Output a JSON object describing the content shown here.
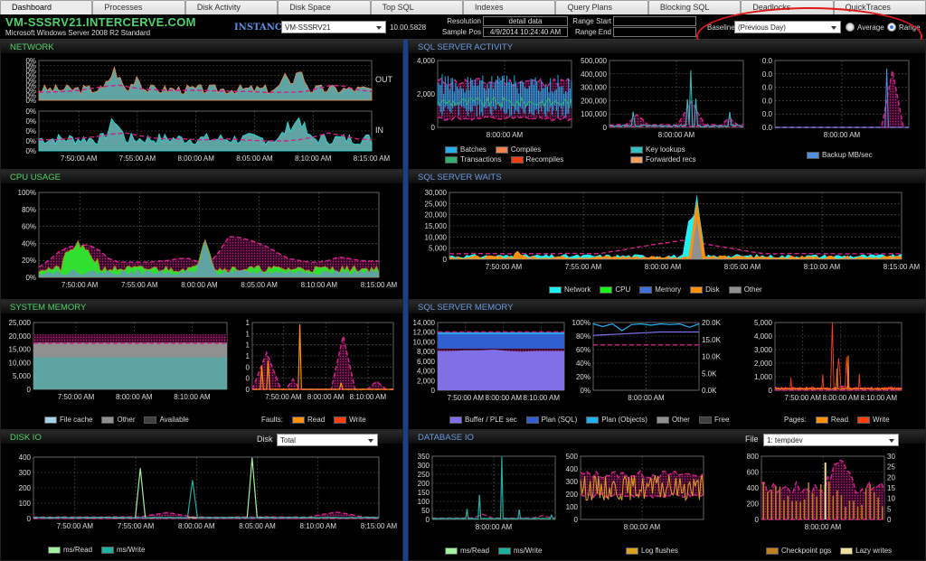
{
  "tabs": [
    {
      "label": "Dashboard",
      "active": true
    },
    {
      "label": "Processes"
    },
    {
      "label": "Disk Activity"
    },
    {
      "label": "Disk Space"
    },
    {
      "label": "Top SQL"
    },
    {
      "label": "Indexes"
    },
    {
      "label": "Query Plans"
    },
    {
      "label": "Blocking SQL"
    },
    {
      "label": "Deadlocks"
    },
    {
      "label": "QuickTraces"
    }
  ],
  "header": {
    "hostname": "VM-SSSRV21.INTERCERVE.COM",
    "os": "Microsoft Windows Server 2008 R2 Standard",
    "instance_label": "INSTANCE",
    "instance_value": "VM-SSSRV21",
    "version": "10.00.5828",
    "resolution_label": "Resolution",
    "resolution_value": "detail data",
    "sample_pos_label": "Sample Pos",
    "sample_pos_value": "4/9/2014 10:24:40 AM",
    "range_start_label": "Range Start",
    "range_start_value": "",
    "range_end_label": "Range End",
    "range_end_value": "",
    "baseline_label": "Baseline",
    "baseline_value": "(Previous Day)",
    "average_label": "Average",
    "range_label": "Range",
    "selected_mode": "Range"
  },
  "panels": {
    "network": {
      "title": "NETWORK",
      "out_label": "OUT",
      "in_label": "IN"
    },
    "sql_activity": {
      "title": "SQL SERVER ACTIVITY"
    },
    "cpu": {
      "title": "CPU USAGE"
    },
    "sql_waits": {
      "title": "SQL SERVER WAITS"
    },
    "system_memory": {
      "title": "SYSTEM MEMORY",
      "faults_label": "Faults:"
    },
    "sql_memory": {
      "title": "SQL SERVER MEMORY",
      "pages_label": "Pages:"
    },
    "disk_io": {
      "title": "DISK IO",
      "disk_label": "Disk",
      "disk_value": "Total"
    },
    "database_io": {
      "title": "DATABASE IO",
      "file_label": "File",
      "file_value": "1: tempdev"
    }
  },
  "colors": {
    "baseline": "#d0208a",
    "teal": "#5fa3a3",
    "cyan": "#20e0e0",
    "orange": "#ff9010",
    "green": "#30e030"
  },
  "chart_data": [
    {
      "id": "net_out",
      "type": "area",
      "yticks": [
        "0%",
        "0%",
        "0%",
        "0%",
        "0%",
        "0%",
        "0%",
        "0%",
        "0%"
      ],
      "xticks": [],
      "series": [
        {
          "name": "Out",
          "color": "#e88850"
        }
      ],
      "values": [
        0.22,
        0.26,
        0.2,
        0.3,
        0.25,
        0.24,
        0.3,
        0.28,
        0.45,
        0.7,
        0.35,
        0.55,
        0.3,
        0.25,
        0.22,
        0.2,
        0.25,
        0.24,
        0.22,
        0.25,
        0.2,
        0.25,
        0.23,
        0.28,
        0.3,
        0.35,
        0.4,
        0.55,
        0.5,
        0.75,
        0.3,
        0.25,
        0.22,
        0.2,
        0.25,
        0.24,
        0.2,
        0.25,
        0.22,
        0.3
      ],
      "baseline": [
        0.2,
        0.21,
        0.22,
        0.25,
        0.3,
        0.35,
        0.38,
        0.32,
        0.28,
        0.26,
        0.25,
        0.25,
        0.25,
        0.24,
        0.23,
        0.22,
        0.22,
        0.2,
        0.2,
        0.2,
        0.22,
        0.3,
        0.38,
        0.35,
        0.26,
        0.22
      ]
    },
    {
      "id": "net_in",
      "type": "area",
      "yticks": [
        "0%",
        "0%",
        "0%",
        "0%",
        "0%"
      ],
      "xticks": [
        "7:50:00 AM",
        "7:55:00 AM",
        "8:00:00 AM",
        "8:05:00 AM",
        "8:10:00 AM",
        "8:15:00 AM"
      ],
      "series": [
        {
          "name": "In",
          "color": "#20e0e0"
        }
      ],
      "values": [
        0.3,
        0.35,
        0.28,
        0.4,
        0.32,
        0.3,
        0.35,
        0.45,
        0.8,
        0.5,
        0.45,
        0.3,
        0.35,
        0.3,
        0.28,
        0.32,
        0.3,
        0.45,
        0.3,
        0.28,
        0.3,
        0.35,
        0.3,
        0.28,
        0.32,
        0.3,
        0.5,
        0.6,
        0.9,
        0.35,
        0.3,
        0.28,
        0.32,
        0.3,
        0.28,
        0.3,
        0.25,
        0.3,
        0.28,
        0.3
      ],
      "baseline": [
        0.28,
        0.28,
        0.3,
        0.32,
        0.36,
        0.42,
        0.45,
        0.38,
        0.32,
        0.3,
        0.3,
        0.28,
        0.28,
        0.3,
        0.28,
        0.26,
        0.25,
        0.25,
        0.28,
        0.35,
        0.45,
        0.38,
        0.3,
        0.28
      ]
    },
    {
      "id": "sql_batches",
      "type": "area",
      "yticks": [
        "4,000",
        "2,000",
        "0"
      ],
      "ymax": 5000,
      "xticks": [
        "8:00:00 AM"
      ],
      "legend": [
        {
          "name": "Batches",
          "color": "#20b0f0"
        },
        {
          "name": "Compiles",
          "color": "#f08050"
        },
        {
          "name": "Transactions",
          "color": "#30b070"
        },
        {
          "name": "Recompiles",
          "color": "#f04010"
        }
      ]
    },
    {
      "id": "sql_lookups",
      "type": "area",
      "yticks": [
        "500,000",
        "400,000",
        "300,000",
        "200,000",
        "100,000",
        "0"
      ],
      "ymax": 500000,
      "xticks": [
        "8:00:00 AM"
      ],
      "legend": [
        {
          "name": "Key lookups",
          "color": "#30c0c0"
        },
        {
          "name": "Forwarded recs",
          "color": "#f0a060"
        }
      ]
    },
    {
      "id": "sql_backup",
      "type": "area",
      "yticks": [
        "0.0",
        "0.0",
        "0.0",
        "0.0",
        "0.0",
        "0.0"
      ],
      "xticks": [
        "8:00:00 AM"
      ],
      "legend": [
        {
          "name": "Backup MB/sec",
          "color": "#5090e0"
        }
      ]
    },
    {
      "id": "cpu",
      "type": "area",
      "yticks": [
        "100%",
        "80%",
        "60%",
        "40%",
        "20%",
        "0%"
      ],
      "ymax": 100,
      "xticks": [
        "7:50:00 AM",
        "7:55:00 AM",
        "8:00:00 AM",
        "8:05:00 AM",
        "8:10:00 AM",
        "8:15:00 AM"
      ],
      "values": [
        8,
        9,
        10,
        12,
        25,
        28,
        30,
        27,
        12,
        10,
        11,
        12,
        10,
        9,
        10,
        11,
        12,
        10,
        11,
        12,
        10,
        9,
        11,
        13,
        15,
        45,
        30,
        15,
        18,
        12,
        10,
        11,
        10,
        12,
        14,
        10,
        11,
        12,
        10,
        9,
        10,
        11,
        12,
        10,
        9,
        10
      ],
      "baseline_high": [
        12,
        20,
        30,
        36,
        38,
        38,
        32,
        22,
        18,
        18,
        18,
        18,
        19,
        20,
        22,
        22,
        18,
        16,
        30,
        48,
        47,
        44,
        40,
        35,
        28,
        22,
        20,
        18,
        18,
        20,
        24,
        22,
        20,
        19,
        19
      ],
      "baseline_low": [
        6,
        6,
        7,
        8,
        9,
        9,
        8,
        7,
        6,
        7,
        8,
        8,
        7,
        6,
        6,
        6,
        7,
        8,
        9,
        8,
        7,
        5,
        4,
        4,
        5,
        6,
        7,
        8,
        8,
        7,
        6,
        5,
        5,
        5,
        5
      ]
    },
    {
      "id": "waits",
      "type": "area",
      "yticks": [
        "30,000",
        "25,000",
        "20,000",
        "15,000",
        "10,000",
        "5,000",
        "0"
      ],
      "ymax": 30000,
      "xticks": [
        "7:50:00 AM",
        "7:55:00 AM",
        "8:00:00 AM",
        "8:05:00 AM",
        "8:10:00 AM",
        "8:15:00 AM"
      ],
      "legend": [
        {
          "name": "Network",
          "color": "#20f0f0"
        },
        {
          "name": "CPU",
          "color": "#20f020"
        },
        {
          "name": "Memory",
          "color": "#4070e0"
        },
        {
          "name": "Disk",
          "color": "#ff9010"
        },
        {
          "name": "Other",
          "color": "#909090"
        }
      ]
    },
    {
      "id": "sys_mem",
      "type": "area",
      "yticks": [
        "25,000",
        "20,000",
        "15,000",
        "10,000",
        "5,000",
        "0"
      ],
      "ymax": 25000,
      "xticks": [
        "7:50:00 AM",
        "8:00:00 AM",
        "8:10:00 AM"
      ],
      "file_cache": 12000,
      "other": 17500,
      "available": 20500,
      "legend": [
        {
          "name": "File cache",
          "color": "#a8d0e8"
        },
        {
          "name": "Other",
          "color": "#909090"
        },
        {
          "name": "Available",
          "color": "#404040"
        }
      ]
    },
    {
      "id": "faults",
      "type": "area",
      "yticks": [
        "1",
        "1",
        "1",
        "1",
        "0",
        "0",
        "0"
      ],
      "xticks": [
        "7:50:00 AM",
        "8:00:00 AM",
        "8:10:00 AM"
      ],
      "legend": [
        {
          "name": "Read",
          "color": "#ff9010"
        },
        {
          "name": "Write",
          "color": "#ff4010"
        }
      ]
    },
    {
      "id": "sql_mem",
      "type": "area",
      "yticks": [
        "14,000",
        "12,000",
        "10,000",
        "8,000",
        "6,000",
        "4,000",
        "2,000",
        "0"
      ],
      "ymax": 14000,
      "xticks": [
        "7:50:00 AM",
        "8:00:00 AM",
        "8:10:00 AM"
      ],
      "legend": [
        {
          "name": "Buffer / PLE sec",
          "color": "#8070e8"
        },
        {
          "name": "Plan (SQL)",
          "color": "#3060d0"
        },
        {
          "name": "Plan (Objects)",
          "color": "#20b0f0"
        },
        {
          "name": "Other",
          "color": "#909090"
        },
        {
          "name": "Free",
          "color": "#404040"
        }
      ]
    },
    {
      "id": "ple",
      "type": "line",
      "yticks": [
        "100%",
        "80%",
        "60%",
        "40%",
        "20%",
        "0%"
      ],
      "y2ticks": [
        "20.0K",
        "15.0K",
        "10.0K",
        "5.0K",
        "0.0K"
      ],
      "xticks": [
        "8:00:00 AM"
      ]
    },
    {
      "id": "pages",
      "type": "area",
      "yticks": [
        "5,000",
        "4,000",
        "3,000",
        "2,000",
        "1,000",
        "0"
      ],
      "ymax": 5000,
      "xticks": [
        "7:50:00 AM",
        "8:00:00 AM",
        "8:10:00 AM"
      ],
      "legend": [
        {
          "name": "Read",
          "color": "#ff9010"
        },
        {
          "name": "Write",
          "color": "#ff4010"
        }
      ]
    },
    {
      "id": "disk_io",
      "type": "line",
      "yticks": [
        "400",
        "300",
        "200",
        "100",
        "0"
      ],
      "ymax": 400,
      "xticks": [
        "7:50:00 AM",
        "7:55:00 AM",
        "8:00:00 AM",
        "8:05:00 AM",
        "8:10:00 AM",
        "8:15:00 AM"
      ],
      "legend": [
        {
          "name": "ms/Read",
          "color": "#a0f0a0"
        },
        {
          "name": "ms/Write",
          "color": "#20b0a0"
        }
      ]
    },
    {
      "id": "db_io",
      "type": "line",
      "yticks": [
        "350",
        "300",
        "250",
        "200",
        "150",
        "100",
        "50",
        "0"
      ],
      "ymax": 350,
      "xticks": [
        "8:00:00 AM"
      ],
      "legend": [
        {
          "name": "ms/Read",
          "color": "#a0f0a0"
        },
        {
          "name": "ms/Write",
          "color": "#20b0a0"
        }
      ]
    },
    {
      "id": "log_flush",
      "type": "line",
      "yticks": [
        "500",
        "400",
        "300",
        "200",
        "100",
        "0"
      ],
      "ymax": 500,
      "xticks": [
        "8:00:00 AM"
      ],
      "legend": [
        {
          "name": "Log flushes",
          "color": "#e0a020"
        }
      ]
    },
    {
      "id": "checkpoint",
      "type": "bar",
      "yticks": [
        "800",
        "600",
        "400",
        "200",
        "0"
      ],
      "y2ticks": [
        "30",
        "25",
        "20",
        "15",
        "10",
        "5",
        "0"
      ],
      "ymax": 800,
      "xticks": [
        "8:00:00 AM"
      ],
      "legend": [
        {
          "name": "Checkpoint pgs",
          "color": "#c08020"
        },
        {
          "name": "Lazy writes",
          "color": "#f0e0a0"
        }
      ]
    }
  ]
}
